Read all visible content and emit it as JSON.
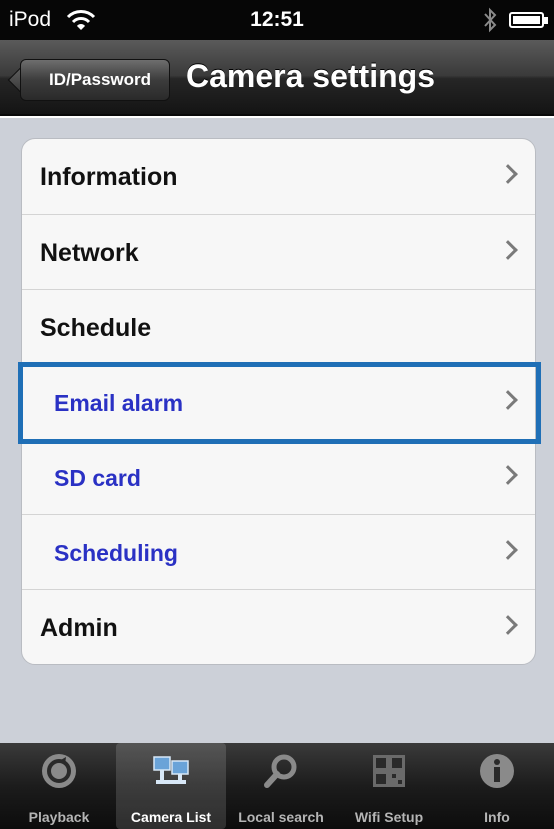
{
  "status_bar": {
    "carrier": "iPod",
    "time": "12:51",
    "icons": [
      "wifi-icon",
      "bluetooth-icon",
      "battery-icon"
    ]
  },
  "nav_bar": {
    "back_label": "ID/Password",
    "title": "Camera settings"
  },
  "settings": {
    "items": [
      {
        "label": "Information"
      },
      {
        "label": "Network"
      },
      {
        "label": "Schedule"
      },
      {
        "label": "Email alarm"
      },
      {
        "label": "SD card"
      },
      {
        "label": "Scheduling"
      },
      {
        "label": "Admin"
      }
    ]
  },
  "colors": {
    "highlight": "#1f6fb6",
    "sub_item_text": "#2a31c4"
  },
  "tab_bar": {
    "tabs": [
      {
        "label": "Playback",
        "icon": "playback-icon"
      },
      {
        "label": "Camera List",
        "icon": "camera-list-icon",
        "active": true
      },
      {
        "label": "Local search",
        "icon": "search-icon"
      },
      {
        "label": "Wifi Setup",
        "icon": "qr-code-icon"
      },
      {
        "label": "Info",
        "icon": "info-icon"
      }
    ]
  }
}
